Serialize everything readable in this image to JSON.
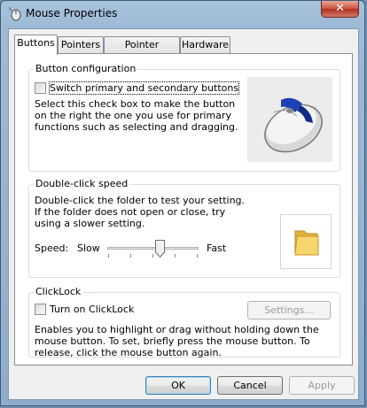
{
  "window": {
    "title": "Mouse Properties",
    "close_glyph": "✕"
  },
  "tabs": [
    {
      "label": "Buttons",
      "active": true
    },
    {
      "label": "Pointers",
      "active": false
    },
    {
      "label": "Pointer Options",
      "active": false
    },
    {
      "label": "Hardware",
      "active": false
    }
  ],
  "button_config": {
    "title": "Button configuration",
    "checkbox_label": "Switch primary and secondary buttons",
    "checked": false,
    "description": "Select this check box to make the button on the right the one you use for primary functions such as selecting and dragging."
  },
  "double_click": {
    "title": "Double-click speed",
    "description": "Double-click the folder to test your setting. If the folder does not open or close, try using a slower setting.",
    "speed_label": "Speed:",
    "slow_label": "Slow",
    "fast_label": "Fast",
    "slider_level": 0.59
  },
  "clicklock": {
    "title": "ClickLock",
    "checkbox_label": "Turn on ClickLock",
    "checked": false,
    "settings_label": "Settings...",
    "description": "Enables you to highlight or drag without holding down the mouse button. To set, briefly press the mouse button. To release, click the mouse button again."
  },
  "footer": {
    "ok_label": "OK",
    "cancel_label": "Cancel",
    "apply_label": "Apply"
  },
  "icons": {
    "title_icon": "mouse-icon",
    "mouse_image": "mouse-illustration",
    "folder": "folder-icon"
  },
  "colors": {
    "title_bar": "#9fbad6",
    "close_button": "#c9503b",
    "accent_button_highlight": "#3c7fb1"
  }
}
